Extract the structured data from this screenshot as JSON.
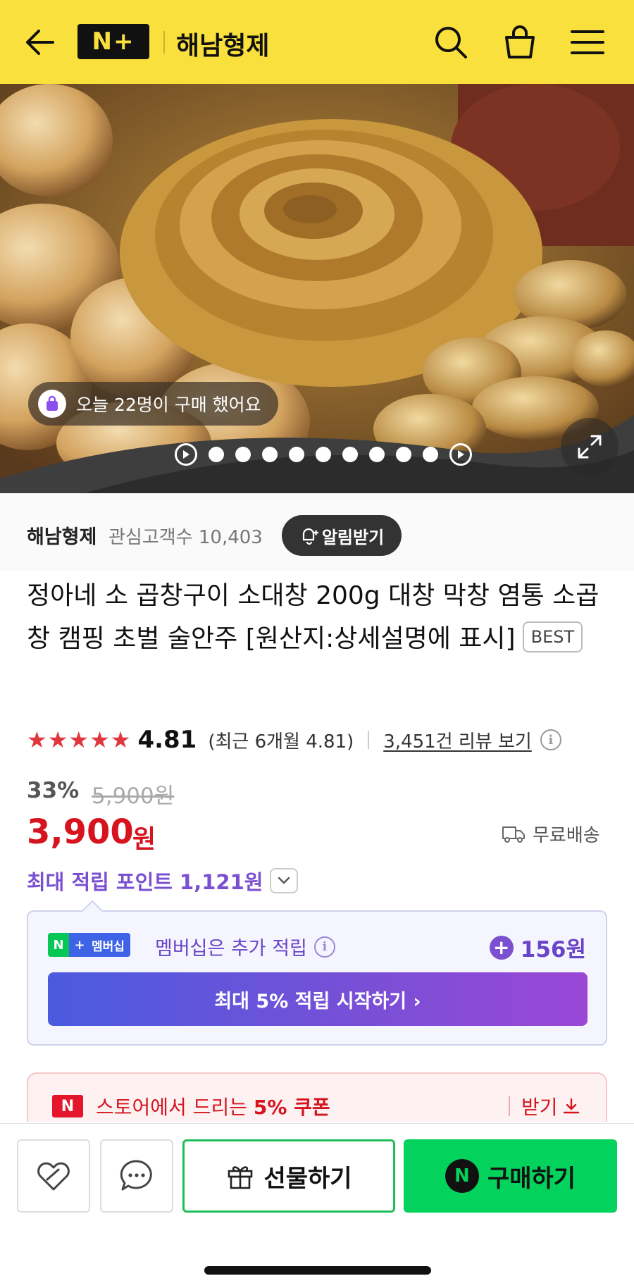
{
  "header": {
    "logo_text": "N+",
    "store_name": "해남형제",
    "bg_color": "#fae03c",
    "icons": [
      "back-arrow-icon",
      "search-icon",
      "shopping-bag-icon",
      "menu-icon"
    ]
  },
  "hero": {
    "image_description_icon": "grilled-beef-intestine-photo",
    "purchase_notice": "오늘 22명이 구매 했어요",
    "slide_count": 9
  },
  "seller": {
    "name": "해남형제",
    "followers_label": "관심고객수 10,403",
    "notify_label": "알림받기"
  },
  "product": {
    "title": "정아네 소 곱창구이 소대창 200g 대창 막창 염통 소곱창 캠핑 초벌 술안주 [원산지:상세설명에 표시]",
    "badge": "BEST"
  },
  "rating": {
    "score": "4.81",
    "stars": 5,
    "recent": "(최근 6개월 4.81)",
    "reviews_link": "3,451건 리뷰 보기"
  },
  "price": {
    "discount": "33%",
    "original": "5,900원",
    "current": "3,900",
    "unit": "원",
    "shipping": "무료배송",
    "points": "최대 적립 포인트 1,121원",
    "accent_color": "#d7141e"
  },
  "membership": {
    "badge_n": "N",
    "badge_plus": "+",
    "badge_label": "멤버십",
    "text": "멤버십은 추가 적립",
    "points": "156원",
    "cta": "최대 5% 적립 시작하기 ›"
  },
  "coupon": {
    "logo": "N",
    "text_prefix": "스토어에서 드리는 ",
    "text_bold": "5% 쿠폰",
    "get_label": "받기"
  },
  "bottom_bar": {
    "gift_label": "선물하기",
    "buy_label": "구매하기",
    "buy_logo": "N",
    "buy_color": "#03d25c"
  }
}
